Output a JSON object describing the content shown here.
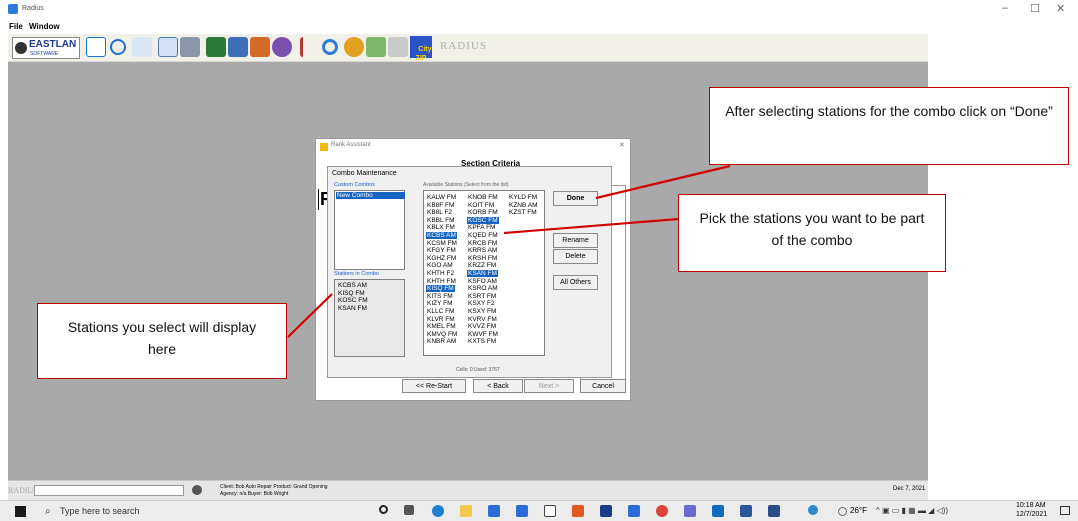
{
  "app": {
    "title": "Radius",
    "menu": [
      "File",
      "Window"
    ],
    "toolbar_logo_text": "EASTLAN",
    "toolbar_logo_sub": "SOFTWARE",
    "toolbar_city_zip": "City\nZIP",
    "toolbar_brand": "RADIUS",
    "window_controls": [
      "–",
      "☐",
      "✕"
    ]
  },
  "dialog": {
    "title": "Rank Assistant",
    "header_text": "Section Criteria",
    "panel_title": "Combo Maintenance",
    "custom_combos_label": "Custom Combos",
    "custom_combos": [
      "New Combo"
    ],
    "available_label": "Available Stations (Select from the list)",
    "col1": [
      "KALW FM",
      "KB8F FM",
      "KB8L F2",
      "KBBL FM",
      "KBLX FM",
      "KCBS AM",
      "KCSM FM",
      "KFGY FM",
      "KGHZ FM",
      "KGO AM",
      "KHTH F2",
      "KHTH FM",
      "KISQ FM",
      "KITS FM",
      "KIZY FM",
      "KLLC FM",
      "KLVR FM",
      "KMEL FM",
      "KMVQ FM",
      "KNBR AM"
    ],
    "col1_selected": [
      5,
      12
    ],
    "col2": [
      "KNOB FM",
      "KOIT FM",
      "KORB FM",
      "KOSC FM",
      "KPFA FM",
      "KQED FM",
      "KRCB FM",
      "KRRS AM",
      "KRSH FM",
      "KRZZ FM",
      "KSAN FM",
      "KSFO AM",
      "KSRO AM",
      "KSRT FM",
      "KSXY F2",
      "KSXY FM",
      "KVRV FM",
      "KVVZ FM",
      "KWVF FM",
      "KXTS FM"
    ],
    "col2_selected": [
      3,
      10
    ],
    "col3": [
      "KYLD FM",
      "KZNB AM",
      "KZST FM"
    ],
    "stations_in_combo_label": "Stations in Combo",
    "stations_in_combo": [
      "KCBS AM",
      "KISQ FM",
      "KOSC FM",
      "KSAN FM"
    ],
    "buttons": {
      "done": "Done",
      "rename": "Rename",
      "delete": "Delete",
      "all_others": "All Others"
    },
    "cells_text": "Cells: 0   Used: 3767",
    "nav": {
      "restart": "<< Re-Start",
      "back": "< Back",
      "next": "Next >",
      "cancel": "Cancel"
    },
    "close": "✕",
    "letter_hint": "R"
  },
  "callouts": {
    "done": "After selecting stations for the combo click on “Done”",
    "pick": "Pick the stations you want to be part of the combo",
    "display": "Stations you select will display here"
  },
  "statusbar": {
    "brand": "RADIUS",
    "client": "Client: Bob Auto Repair   Product: Grand Opening",
    "agency": "Agency: n/a   Buyer: Bob Wright",
    "date": "Dec 7, 2021"
  },
  "taskbar": {
    "search_placeholder": "Type here to search",
    "temp": "26°F",
    "time": "10:18 AM",
    "date": "12/7/2021"
  }
}
